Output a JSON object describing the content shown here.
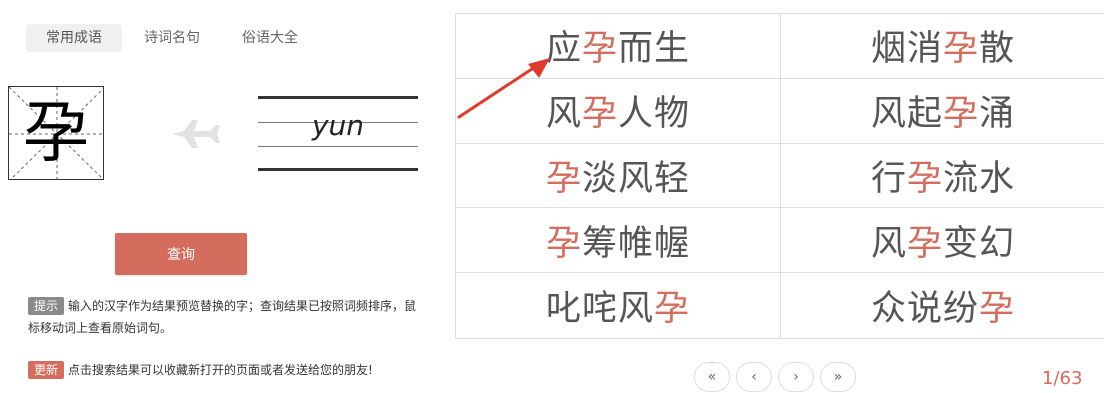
{
  "tabs": [
    {
      "label": "常用成语",
      "active": true
    },
    {
      "label": "诗词名句",
      "active": false
    },
    {
      "label": "俗语大全",
      "active": false
    }
  ],
  "character": "孕",
  "pinyin": "yun",
  "query_label": "查询",
  "tips": [
    {
      "badge": "提示",
      "text": "输入的汉字作为结果预览替换的字；查询结果已按照词频排序，鼠标移动词上查看原始词句。"
    },
    {
      "badge": "更新",
      "text": "点击搜索结果可以收藏新打开的页面或者发送给您的朋友!"
    }
  ],
  "results": [
    {
      "pre": "应",
      "hl": "孕",
      "post": "而生"
    },
    {
      "pre": "烟消",
      "hl": "孕",
      "post": "散"
    },
    {
      "pre": "风",
      "hl": "孕",
      "post": "人物"
    },
    {
      "pre": "风起",
      "hl": "孕",
      "post": "涌"
    },
    {
      "pre": "",
      "hl": "孕",
      "post": "淡风轻"
    },
    {
      "pre": "行",
      "hl": "孕",
      "post": "流水"
    },
    {
      "pre": "",
      "hl": "孕",
      "post": "筹帷幄"
    },
    {
      "pre": "风",
      "hl": "孕",
      "post": "变幻"
    },
    {
      "pre": "叱咤风",
      "hl": "孕",
      "post": ""
    },
    {
      "pre": "众说纷",
      "hl": "孕",
      "post": ""
    }
  ],
  "pager": {
    "first": "«",
    "prev": "‹",
    "next": "›",
    "last": "»"
  },
  "page_indicator": "1/63",
  "colors": {
    "accent": "#d46d5d",
    "badge_gray": "#8a8a8a",
    "tab_active_bg": "#f0f0f0"
  },
  "icons": {
    "plane": "airplane-icon",
    "arrow": "red-arrow-pointer"
  }
}
